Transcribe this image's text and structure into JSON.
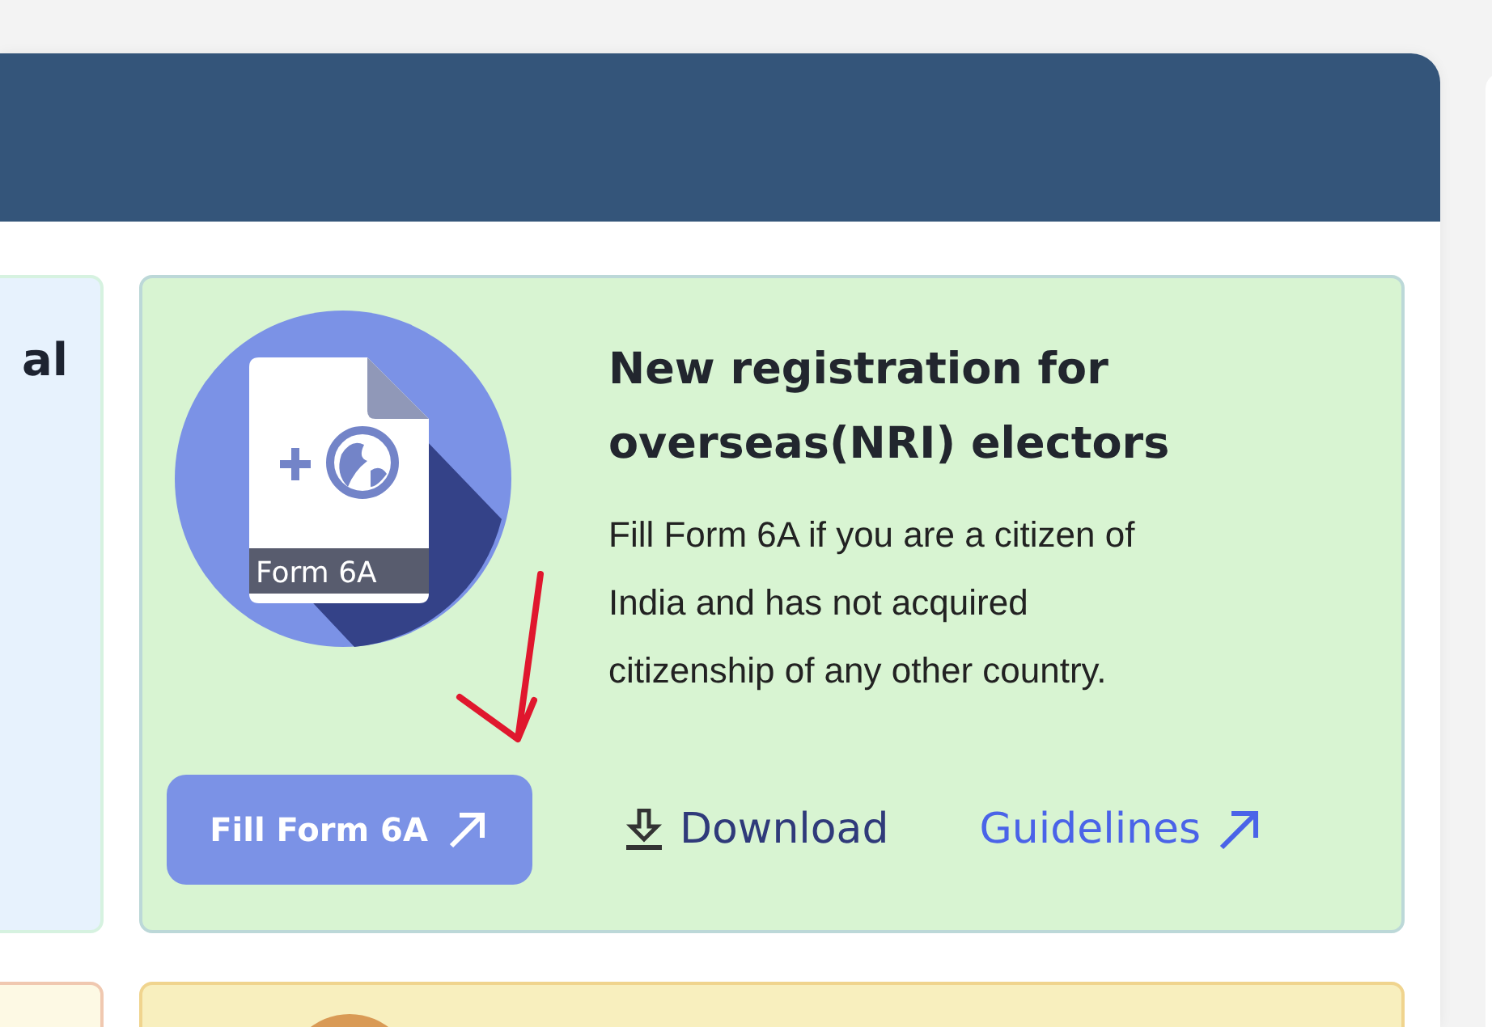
{
  "left_card": {
    "title": "al"
  },
  "main_card": {
    "icon_label": "Form 6A",
    "title_lines": [
      "New registration for",
      "overseas(NRI) electors"
    ],
    "description_lines": [
      "Fill Form 6A if you are a citizen of",
      "India and has not acquired",
      "citizenship of any other country."
    ],
    "primary_button": "Fill Form 6A",
    "download_link": "Download",
    "guidelines_link": "Guidelines"
  }
}
